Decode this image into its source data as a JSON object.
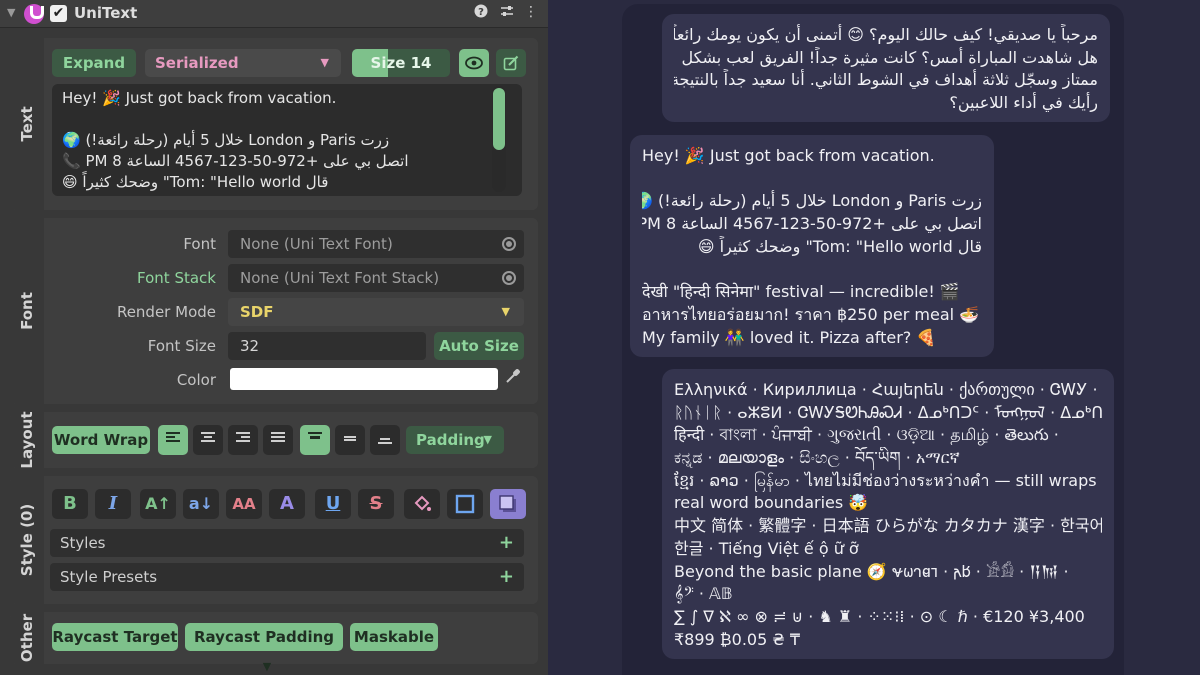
{
  "header": {
    "title": "UniText",
    "enabled_mark": "✔",
    "icons": [
      "help-icon",
      "settings-sliders-icon",
      "more-vertical-icon"
    ]
  },
  "text_section": {
    "label": "Text",
    "expand_label": "Expand",
    "serialized_label": "Serialized",
    "size_label": "Size 14",
    "lines": [
      "Hey! 🎉 Just got back from vacation.",
      "",
      "زرت Paris و London خلال 5 أيام (رحلة رائعة!) 🌍",
      "اتصل بي على +972-50-123-4567 الساعة 8 PM 📞",
      "قال Tom: \"Hello world\" وضحك كثيراً 😄"
    ]
  },
  "font_section": {
    "label": "Font",
    "font_label": "Font",
    "font_value": "None (Uni Text Font)",
    "font_stack_label": "Font Stack",
    "font_stack_value": "None (Uni Text Font Stack)",
    "render_mode_label": "Render Mode",
    "render_mode_value": "SDF",
    "font_size_label": "Font Size",
    "font_size_value": "32",
    "auto_size_label": "Auto Size",
    "color_label": "Color",
    "color_value": "#FFFFFF"
  },
  "layout_section": {
    "label": "Layout",
    "word_wrap_label": "Word Wrap",
    "padding_label": "Padding"
  },
  "style_section": {
    "label": "Style (0)",
    "styles_label": "Styles",
    "style_presets_label": "Style Presets",
    "buttons": {
      "bold": "B",
      "italic": "I",
      "upper": "A↑",
      "lower": "a↓",
      "smallcaps": "AA",
      "outline": "A",
      "underline": "U",
      "strike": "S"
    }
  },
  "other_section": {
    "label": "Other",
    "raycast_target_label": "Raycast Target",
    "raycast_padding_label": "Raycast Padding",
    "maskable_label": "Maskable"
  },
  "preview": {
    "bubble1": [
      "مرحباً يا صديقي! كيف حالك اليوم؟ 😊 أتمنى أن يكون يومك رائعاً.",
      "هل شاهدت المباراة أمس؟ كانت مثيرة جداً! الفريق لعب بشكل",
      "ممتاز وسجّل ثلاثة أهداف في الشوط الثاني. أنا سعيد جداً بالنتيجة. ما",
      "رأيك في أداء اللاعبين؟"
    ],
    "bubble2": [
      "Hey! 🎉 Just got back from vacation.",
      "",
      "زرت Paris و London خلال 5 أيام (رحلة رائعة!) 🌍",
      "اتصل بي على +972-50-123-4567 الساعة 8 PM 📞",
      "قال Tom: \"Hello world\" وضحك كثيراً 😄",
      "",
      "देखी \"हिन्दी सिनेमा\" festival — incredible! 🎬",
      "อาหารไทยอร่อยมาก! ราคา ฿250 per meal 🍜",
      "My family 👫 loved it. Pizza after? 🍕"
    ],
    "bubble3": [
      "Ελληνικά · Кириллица · Հայերեն · ქართული · ᏣᎳᎩ ·",
      "ᚱᚢᚾᛁᚱ · ⴰⵣⵓⵍ · ᏣᎳᎩᎦᏬᏂᎯᏍᏗ · ᐃᓄᒃᑎᑐᑦ · ᠮᠣᠩᠭᠣᠯ · ᐃᓄᒃᑎᑐᑦ",
      "हिन्दी · বাংলা · ਪੰਜਾਬੀ · ગુજરાતી · ଓଡ଼ିଆ · தமிழ் · తెలుగు ·",
      "ಕನ್ನಡ · മലയാളം · සිංහල · བོད་ཡིག · አማርኛ",
      "ខ្មែរ · ລາວ · မြန်မာ · ไทยไม่มีช่องว่างระหว่างคำ — still wraps on",
      "real word boundaries 🤯",
      "中文 简体 · 繁體字 · 日本語 ひらがな カタカナ 漢字 · 한국어",
      "한글 · Tiếng Việt ế ộ ữ ỡ",
      "Beyond the basic plane 🧭 𐐷𐐶𐐻𐐼𐐹 · 𐌰𐌱 · 𓀀𓀁 · 𒀀𒀁 ·",
      "𝄞𝄢 · 𝔸𝔹",
      "∑ ∫ ∇ ℵ ∞ ⊗ ≓ ⊍ · ♞ ♜ · ⁘⁙⁝⁞ · ⊙ ☾ ℏ · €120 ¥3,400",
      "₹899 ₿0.05 ₴ ₸"
    ]
  }
}
